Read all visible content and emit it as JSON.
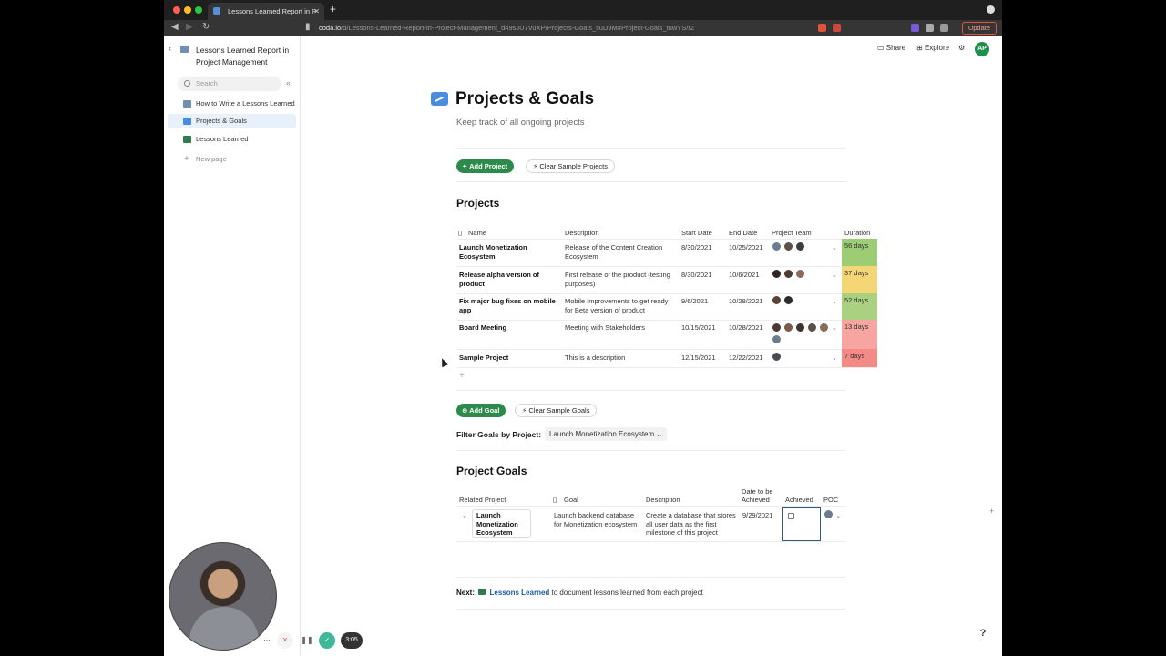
{
  "browser": {
    "tab_title": "Lessons Learned Report in P",
    "url_host": "coda.io",
    "url_path": "/d/Lessons-Learned-Report-in-Project-Management_d49sJU7VuXP/Projects-Goals_suD9M#Project-Goals_tuwYS/r2",
    "update_label": "Update"
  },
  "sidebar": {
    "doc_title": "Lessons Learned Report in Project Management",
    "search_placeholder": "Search",
    "items": [
      {
        "label": "How to Write a Lessons Learned",
        "color": "#6f8fb5"
      },
      {
        "label": "Projects & Goals",
        "color": "#4a8de0"
      },
      {
        "label": "Lessons Learned",
        "color": "#2f7d4d"
      }
    ],
    "new_page_label": "New page"
  },
  "toolbar": {
    "share_label": "Share",
    "explore_label": "Explore",
    "avatar_initials": "AP"
  },
  "page": {
    "title": "Projects & Goals",
    "subtitle": "Keep track of all ongoing projects",
    "add_project_label": "Add Project",
    "clear_projects_label": "Clear Sample Projects",
    "projects_heading": "Projects",
    "add_goal_label": "Add Goal",
    "clear_goals_label": "Clear Sample Goals",
    "filter_label": "Filter Goals by Project:",
    "filter_value": "Launch Monetization Ecosystem",
    "goals_heading": "Project Goals",
    "next_prefix": "Next:",
    "next_link": "Lessons Learned",
    "next_suffix": "to document lessons learned from each project"
  },
  "projects_table": {
    "columns": [
      "Name",
      "Description",
      "Start Date",
      "End Date",
      "Project Team",
      "Duration"
    ],
    "rows": [
      {
        "name": "Launch Monetization Ecosystem",
        "description": "Release of the Content Creation Ecosystem",
        "start": "8/30/2021",
        "end": "10/25/2021",
        "duration": "56 days",
        "duration_color": "#9ccc73",
        "team": 3
      },
      {
        "name": "Release alpha version of product",
        "description": "First release of the product (testing purposes)",
        "start": "8/30/2021",
        "end": "10/6/2021",
        "duration": "37 days",
        "duration_color": "#f5d676",
        "team": 3
      },
      {
        "name": "Fix major bug fixes on mobile app",
        "description": "Mobile Improvements to get ready for Beta version of product",
        "start": "9/6/2021",
        "end": "10/28/2021",
        "duration": "52 days",
        "duration_color": "#a9d17f",
        "team": 2
      },
      {
        "name": "Board Meeting",
        "description": "Meeting with Stakeholders",
        "start": "10/15/2021",
        "end": "10/28/2021",
        "duration": "13 days",
        "duration_color": "#f6a5a0",
        "team": 6
      },
      {
        "name": "Sample Project",
        "description": "This is a description",
        "start": "12/15/2021",
        "end": "12/22/2021",
        "duration": "7 days",
        "duration_color": "#f48a86",
        "team": 1
      }
    ]
  },
  "goals_table": {
    "columns": [
      "Related Project",
      "Goal",
      "Description",
      "Date to be Achieved",
      "Achieved",
      "POC"
    ],
    "rows": [
      {
        "project": "Launch Monetization Ecosystem",
        "goal": "Launch backend database for Monetization ecosystem",
        "description": "Create a database that stores all user data as the first milestone of this project",
        "date": "9/29/2021"
      }
    ]
  },
  "recorder": {
    "time": "3:05"
  },
  "help_label": "?"
}
